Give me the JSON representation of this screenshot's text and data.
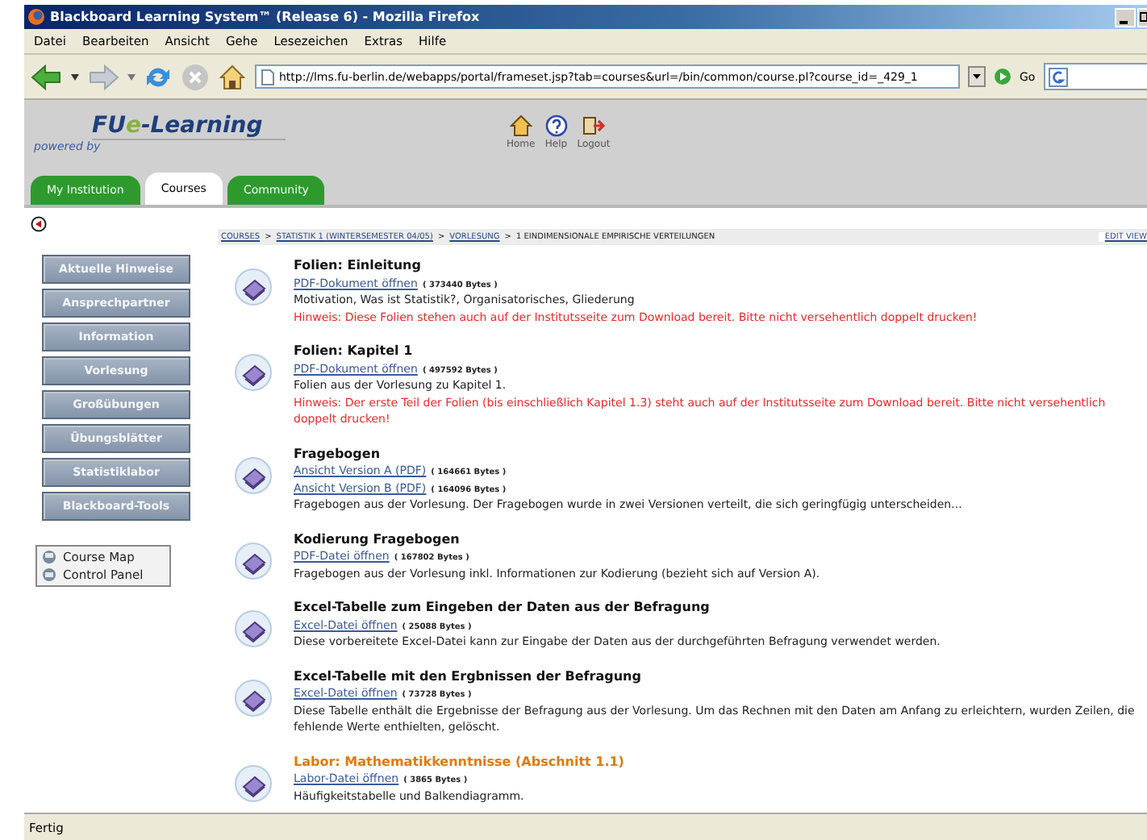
{
  "window": {
    "title": "Blackboard Learning System™ (Release 6) - Mozilla Firefox"
  },
  "menu": [
    "Datei",
    "Bearbeiten",
    "Ansicht",
    "Gehe",
    "Lesezeichen",
    "Extras",
    "Hilfe"
  ],
  "toolbar": {
    "url": "http://lms.fu-berlin.de/webapps/portal/frameset.jsp?tab=courses&url=/bin/common/course.pl?course_id=_429_1",
    "go": "Go"
  },
  "header": {
    "logo": {
      "prefix": "FU",
      "accent": "e",
      "suffix": "-Learning"
    },
    "tagline": "powered by",
    "links": [
      {
        "kind": "home",
        "label": "Home"
      },
      {
        "kind": "help",
        "label": "Help"
      },
      {
        "kind": "logout",
        "label": "Logout"
      }
    ]
  },
  "tabs": [
    {
      "label": "My Institution",
      "selected": false
    },
    {
      "label": "Courses",
      "selected": true
    },
    {
      "label": "Community",
      "selected": false
    }
  ],
  "breadcrumb": {
    "separator": ">",
    "items": [
      {
        "label": "COURSES",
        "link": true
      },
      {
        "label": "STATISTIK 1 (WINTERSEMESTER 04/05)",
        "link": true
      },
      {
        "label": "VORLESUNG",
        "link": true
      },
      {
        "label": "1 EINDIMENSIONALE EMPIRISCHE VERTEILUNGEN",
        "link": false
      }
    ],
    "edit_view": "EDIT VIEW"
  },
  "sidebar": {
    "buttons": [
      "Aktuelle Hinweise",
      "Ansprechpartner",
      "Information",
      "Vorlesung",
      "Großübungen",
      "Übungsblätter",
      "Statistiklabor",
      "Blackboard-Tools"
    ],
    "tools": [
      {
        "label": "Course Map"
      },
      {
        "label": "Control Panel"
      }
    ]
  },
  "items": [
    {
      "title": "Folien: Einleitung",
      "accent": false,
      "links": [
        {
          "label": "PDF-Dokument öffnen",
          "size": "( 373440 Bytes )"
        }
      ],
      "description": "Motivation, Was ist Statistik?, Organisatorisches, Gliederung",
      "note": "Hinweis: Diese Folien stehen auch auf der Institutsseite zum Download bereit. Bitte nicht versehentlich doppelt drucken!"
    },
    {
      "title": "Folien: Kapitel 1",
      "accent": false,
      "links": [
        {
          "label": "PDF-Dokument öffnen",
          "size": "( 497592 Bytes )"
        }
      ],
      "description": "Folien aus der Vorlesung zu Kapitel 1.",
      "note": "Hinweis: Der erste Teil der Folien (bis einschließlich Kapitel 1.3) steht auch auf der Institutsseite zum Download bereit. Bitte nicht versehentlich doppelt drucken!"
    },
    {
      "title": "Fragebogen",
      "accent": false,
      "links": [
        {
          "label": "Ansicht Version A (PDF)",
          "size": "( 164661 Bytes )"
        },
        {
          "label": "Ansicht Version B (PDF)",
          "size": "( 164096 Bytes )"
        }
      ],
      "description": "Fragebogen aus der Vorlesung. Der Fragebogen wurde in zwei Versionen verteilt, die sich geringfügig unterscheiden..."
    },
    {
      "title": "Kodierung Fragebogen",
      "accent": false,
      "links": [
        {
          "label": "PDF-Datei öffnen",
          "size": "( 167802 Bytes )"
        }
      ],
      "description": "Fragebogen aus der Vorlesung inkl. Informationen zur Kodierung (bezieht sich auf Version A)."
    },
    {
      "title": "Excel-Tabelle zum Eingeben der Daten aus der Befragung",
      "accent": false,
      "links": [
        {
          "label": "Excel-Datei öffnen",
          "size": "( 25088 Bytes )"
        }
      ],
      "description": "Diese vorbereitete Excel-Datei kann zur Eingabe der Daten aus der durchgeführten Befragung verwendet werden."
    },
    {
      "title": "Excel-Tabelle mit den Ergbnissen der Befragung",
      "accent": false,
      "links": [
        {
          "label": "Excel-Datei öffnen",
          "size": "( 73728 Bytes )"
        }
      ],
      "description": "Diese Tabelle enthält die Ergebnisse der Befragung aus der Vorlesung. Um das Rechnen mit den Daten am Anfang zu erleichtern, wurden Zeilen, die fehlende Werte enthielten, gelöscht."
    },
    {
      "title": "Labor: Mathematikkenntnisse (Abschnitt 1.1)",
      "accent": true,
      "links": [
        {
          "label": "Labor-Datei öffnen",
          "size": "( 3865 Bytes )"
        }
      ],
      "description": "Häufigkeitstabelle und Balkendiagramm."
    }
  ],
  "status_bar": "Fertig"
}
